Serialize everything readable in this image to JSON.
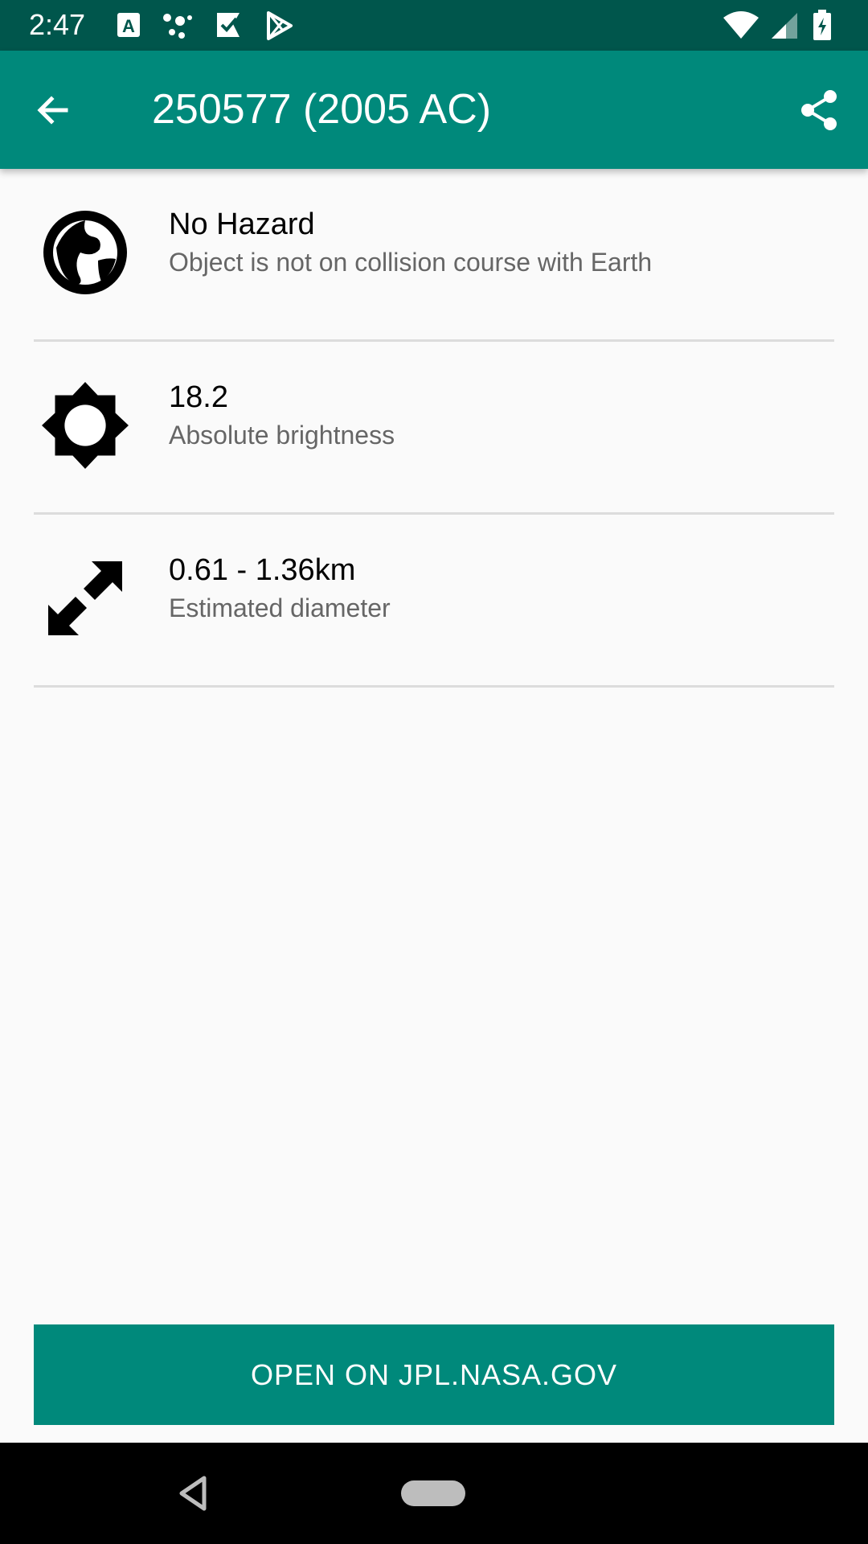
{
  "status_bar": {
    "time": "2:47",
    "icons": [
      "text-a-icon",
      "dots-icon",
      "check-flag-icon",
      "play-store-icon",
      "wifi-icon",
      "signal-icon",
      "battery-charging-icon"
    ]
  },
  "app_bar": {
    "title": "250577 (2005 AC)",
    "back_icon": "arrow-back-icon",
    "share_icon": "share-icon",
    "color": "#00897b",
    "status_color": "#00564c"
  },
  "details": [
    {
      "icon": "globe-icon",
      "title": "No Hazard",
      "subtitle": "Object is not on collision course with Earth"
    },
    {
      "icon": "brightness-icon",
      "title": "18.2",
      "subtitle": "Absolute brightness"
    },
    {
      "icon": "diameter-arrows-icon",
      "title": "0.61 - 1.36km",
      "subtitle": "Estimated diameter"
    }
  ],
  "open_button": {
    "label": "OPEN ON JPL.NASA.GOV"
  },
  "nav_bar": {
    "back_icon": "nav-back-icon",
    "home_icon": "nav-home-icon"
  }
}
